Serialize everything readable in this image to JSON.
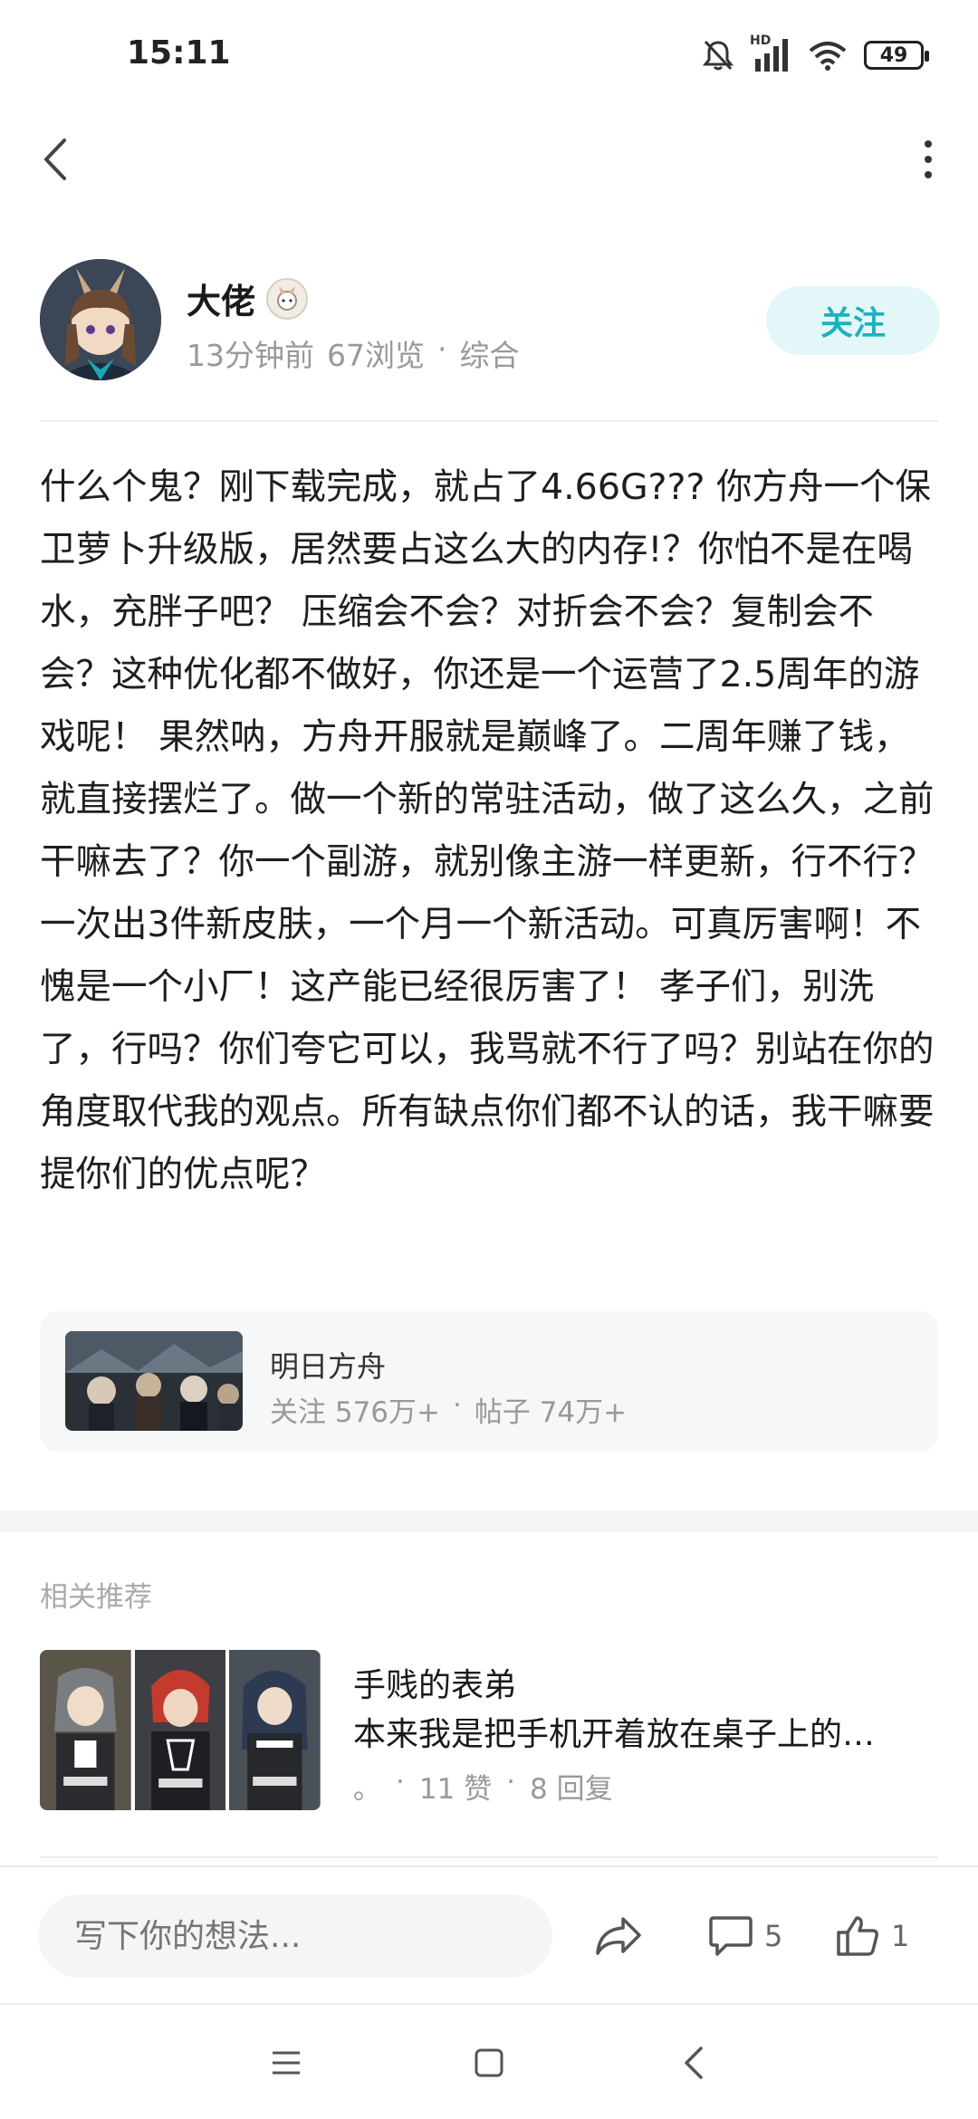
{
  "status_bar": {
    "time": "15:11",
    "network_label": "HD",
    "battery": "49"
  },
  "nav": {
    "back_icon": "back-arrow-icon",
    "more_icon": "more-vertical-icon"
  },
  "author": {
    "name": "大佬",
    "time_ago": "13分钟前",
    "views": "67浏览",
    "dot": "·",
    "category": "综合",
    "follow_label": "关注"
  },
  "post": {
    "text": "什么个鬼？刚下载完成，就占了4.66G???  你方舟一个保卫萝卜升级版，居然要占这么大的内存!？你怕不是在喝水，充胖子吧？ 压缩会不会？对折会不会？复制会不会？这种优化都不做好，你还是一个运营了2.5周年的游戏呢！ 果然呐，方舟开服就是巅峰了。二周年赚了钱，就直接摆烂了。做一个新的常驻活动，做了这么久，之前干嘛去了？你一个副游，就别像主游一样更新，行不行？一次出3件新皮肤，一个月一个新活动。可真厉害啊！不愧是一个小厂！这产能已经很厉害了！ 孝子们，别洗了，行吗？你们夸它可以，我骂就不行了吗？别站在你的角度取代我的观点。所有缺点你们都不认的话，我干嘛要提你们的优点呢？"
  },
  "topic": {
    "name": "明日方舟",
    "followers": "关注 576万+",
    "dot": "·",
    "posts": "帖子 74万+"
  },
  "recommend": {
    "heading": "相关推荐",
    "items": [
      {
        "author": "手贱的表弟",
        "title": "本来我是把手机开着放在桌子上的…",
        "meta_prefix": "。",
        "dot": "·",
        "likes": "11 赞",
        "replies": "8 回复"
      }
    ]
  },
  "action_bar": {
    "input_placeholder": "写下你的想法...",
    "comment_count": "5",
    "like_count": "1"
  },
  "colors": {
    "accent": "#1bb2bf",
    "accent_bg": "#e4f7f8",
    "muted": "#999999"
  }
}
